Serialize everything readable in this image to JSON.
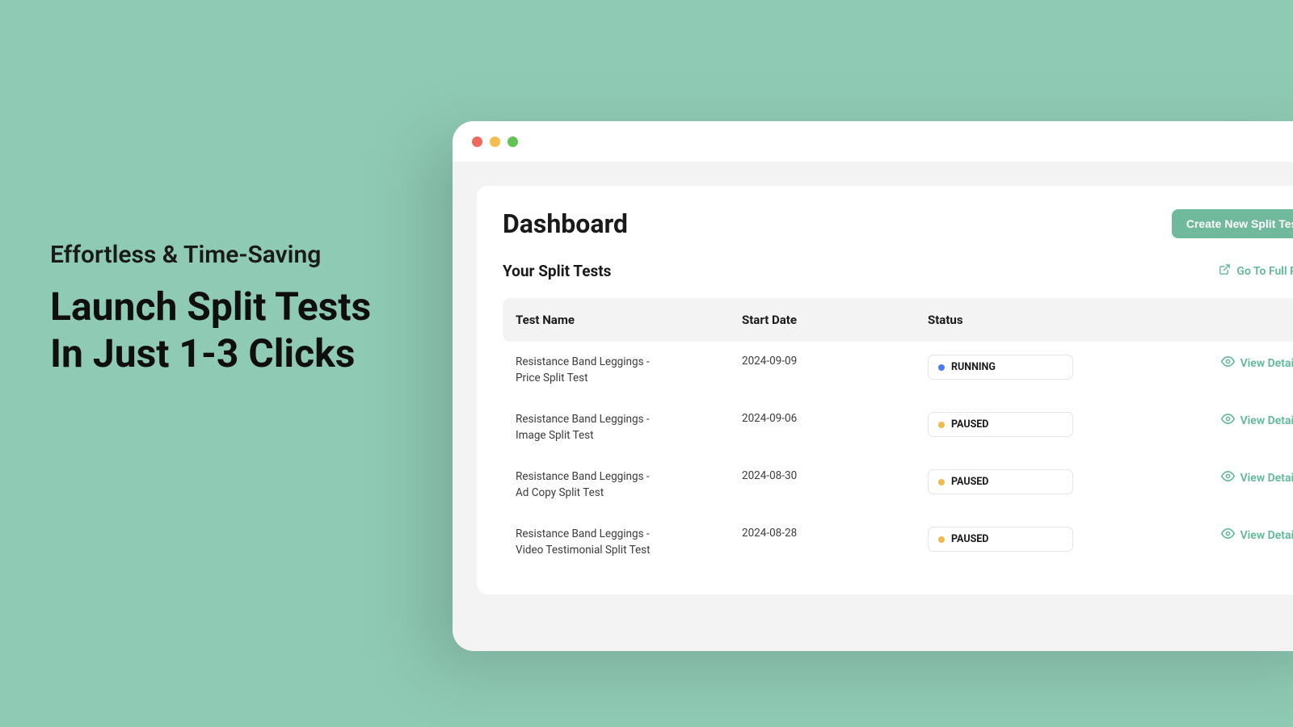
{
  "marketing": {
    "eyebrow": "Effortless & Time-Saving",
    "headline_l1": "Launch Split Tests",
    "headline_l2": "In Just 1-3 Clicks"
  },
  "header": {
    "title": "Dashboard",
    "create_button": "Create New Split Test"
  },
  "section": {
    "title": "Your Split Tests",
    "full_page_link": "Go To Full Page"
  },
  "table": {
    "columns": {
      "name": "Test Name",
      "date": "Start Date",
      "status": "Status"
    },
    "view_details": "View Details",
    "status_labels": {
      "running": "RUNNING",
      "paused": "PAUSED"
    },
    "rows": [
      {
        "name": "Resistance Band Leggings - Price Split Test",
        "date": "2024-09-09",
        "status": "running"
      },
      {
        "name": "Resistance Band Leggings - Image Split Test",
        "date": "2024-09-06",
        "status": "paused"
      },
      {
        "name": "Resistance Band Leggings - Ad Copy Split Test",
        "date": "2024-08-30",
        "status": "paused"
      },
      {
        "name": "Resistance Band Leggings - Video Testimonial Split Test",
        "date": "2024-08-28",
        "status": "paused"
      }
    ]
  }
}
